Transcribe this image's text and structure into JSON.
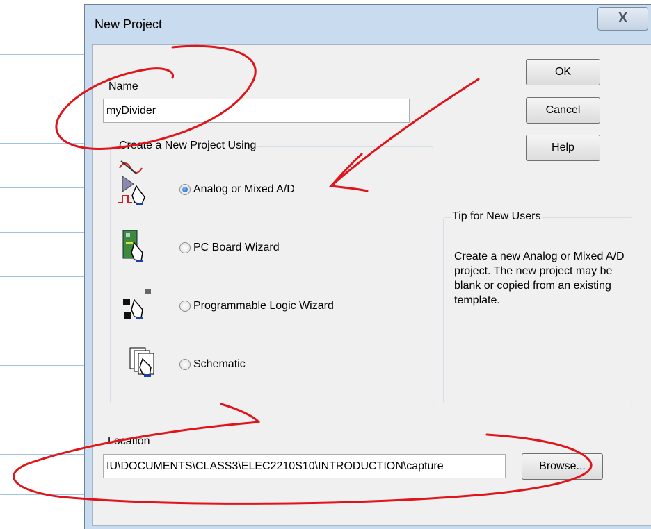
{
  "dialog": {
    "title": "New Project",
    "close_label": "X"
  },
  "name_section": {
    "label": "Name",
    "value": "myDivider"
  },
  "buttons": {
    "ok": "OK",
    "cancel": "Cancel",
    "help": "Help",
    "browse": "Browse..."
  },
  "create_group": {
    "title": "Create a New Project Using",
    "options": [
      {
        "label": "Analog or Mixed A/D",
        "checked": true,
        "icon": "analog-mixed-icon"
      },
      {
        "label": "PC Board Wizard",
        "checked": false,
        "icon": "pc-board-icon"
      },
      {
        "label": "Programmable Logic Wizard",
        "checked": false,
        "icon": "programmable-logic-icon"
      },
      {
        "label": "Schematic",
        "checked": false,
        "icon": "schematic-icon"
      }
    ]
  },
  "tip": {
    "title": "Tip for New Users",
    "text": "Create a new Analog or Mixed A/D project.  The new project may be blank or copied from an existing template."
  },
  "location": {
    "label": "Location",
    "value": "IU\\DOCUMENTS\\CLASS3\\ELEC2210S10\\INTRODUCTION\\capture"
  },
  "colors": {
    "annotation_red": "#e0141b",
    "titlebar": "#c9dcef",
    "dialog_body": "#f0f0f0"
  }
}
